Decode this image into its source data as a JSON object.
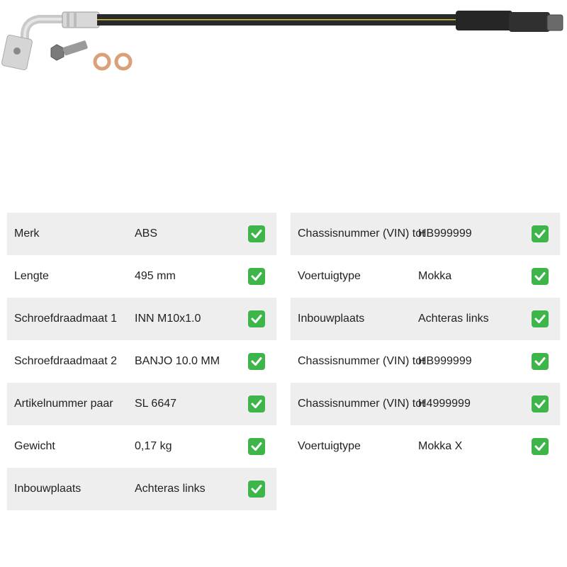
{
  "specs_left": [
    {
      "label": "Merk",
      "value": "ABS"
    },
    {
      "label": "Lengte",
      "value": "495 mm"
    },
    {
      "label": "Schroefdraadmaat 1",
      "value": "INN M10x1.0"
    },
    {
      "label": "Schroefdraadmaat 2",
      "value": "BANJO 10.0 MM"
    },
    {
      "label": "Artikelnummer paar",
      "value": "SL 6647"
    },
    {
      "label": "Gewicht",
      "value": "0,17 kg"
    },
    {
      "label": "Inbouwplaats",
      "value": "Achteras links"
    }
  ],
  "specs_right": [
    {
      "label": "Chassisnummer (VIN) tot",
      "value": "HB999999"
    },
    {
      "label": "Voertuigtype",
      "value": "Mokka"
    },
    {
      "label": "Inbouwplaats",
      "value": "Achteras links"
    },
    {
      "label": "Chassisnummer (VIN) tot",
      "value": "HB999999"
    },
    {
      "label": "Chassisnummer (VIN) tot",
      "value": "H4999999"
    },
    {
      "label": "Voertuigtype",
      "value": "Mokka X"
    }
  ],
  "icons": {
    "check": "check-icon",
    "product": "brake-hose-image"
  },
  "colors": {
    "check": "#3db54a",
    "row_shade": "#eeeeee"
  }
}
